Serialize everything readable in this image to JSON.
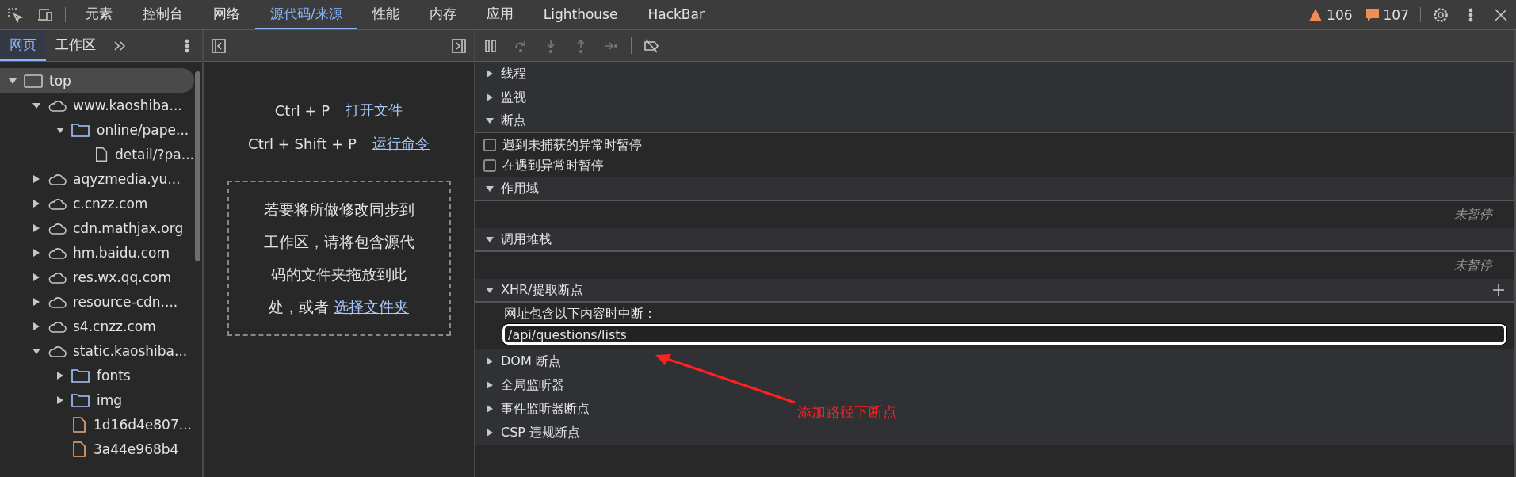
{
  "toolbar": {
    "tabs": [
      {
        "label": "元素",
        "selected": false
      },
      {
        "label": "控制台",
        "selected": false
      },
      {
        "label": "网络",
        "selected": false
      },
      {
        "label": "源代码/来源",
        "selected": true
      },
      {
        "label": "性能",
        "selected": false
      },
      {
        "label": "内存",
        "selected": false
      },
      {
        "label": "应用",
        "selected": false
      },
      {
        "label": "Lighthouse",
        "selected": false
      },
      {
        "label": "HackBar",
        "selected": false
      }
    ],
    "warnings": "106",
    "issues": "107"
  },
  "navigator": {
    "tabs": [
      {
        "label": "网页",
        "selected": true
      },
      {
        "label": "工作区",
        "selected": false
      }
    ],
    "tree": [
      {
        "label": "top",
        "kind": "frame",
        "expanded": true,
        "selected": true,
        "children": [
          {
            "label": "www.kaoshiba...",
            "kind": "domain",
            "expanded": true,
            "selected": false,
            "children": [
              {
                "label": "online/pape...",
                "kind": "folder",
                "expanded": true,
                "selected": false,
                "children": [
                  {
                    "label": "detail/?pa...",
                    "kind": "document",
                    "selected": false
                  }
                ]
              }
            ]
          },
          {
            "label": "aqyzmedia.yu...",
            "kind": "domain",
            "expanded": false,
            "selected": false
          },
          {
            "label": "c.cnzz.com",
            "kind": "domain",
            "expanded": false,
            "selected": false
          },
          {
            "label": "cdn.mathjax.org",
            "kind": "domain",
            "expanded": false,
            "selected": false
          },
          {
            "label": "hm.baidu.com",
            "kind": "domain",
            "expanded": false,
            "selected": false
          },
          {
            "label": "res.wx.qq.com",
            "kind": "domain",
            "expanded": false,
            "selected": false
          },
          {
            "label": "resource-cdn....",
            "kind": "domain",
            "expanded": false,
            "selected": false
          },
          {
            "label": "s4.cnzz.com",
            "kind": "domain",
            "expanded": false,
            "selected": false
          },
          {
            "label": "static.kaoshiba...",
            "kind": "domain",
            "expanded": true,
            "selected": false,
            "children": [
              {
                "label": "fonts",
                "kind": "folder",
                "expanded": false,
                "selected": false
              },
              {
                "label": "img",
                "kind": "folder",
                "expanded": false,
                "selected": false
              },
              {
                "label": "1d16d4e807...",
                "kind": "resource",
                "selected": false
              },
              {
                "label": "3a44e968b4",
                "kind": "resource",
                "selected": false
              }
            ]
          }
        ]
      }
    ]
  },
  "editor": {
    "shortcuts": [
      {
        "keys": "Ctrl + P",
        "action": "打开文件"
      },
      {
        "keys": "Ctrl + Shift + P",
        "action": "运行命令"
      }
    ],
    "hint": "若要将所做修改同步到工作区，请将包含源代码的文件夹拖放到此处，或者",
    "hint_link": "选择文件夹"
  },
  "debugger": {
    "sections": [
      {
        "title": "线程",
        "expanded": false
      },
      {
        "title": "监视",
        "expanded": false
      },
      {
        "title": "断点",
        "expanded": true,
        "body": [
          {
            "kind": "checkbox",
            "label": "遇到未捕获的异常时暂停",
            "checked": false
          },
          {
            "kind": "checkbox",
            "label": "在遇到异常时暂停",
            "checked": false
          }
        ]
      },
      {
        "title": "作用域",
        "expanded": true,
        "body": [
          {
            "kind": "status",
            "label": "未暂停"
          }
        ]
      },
      {
        "title": "调用堆栈",
        "expanded": true,
        "body": [
          {
            "kind": "status",
            "label": "未暂停"
          }
        ]
      },
      {
        "title": "XHR/提取断点",
        "expanded": true,
        "addable": true,
        "body": [
          {
            "kind": "caption",
            "label": "网址包含以下内容时中断："
          },
          {
            "kind": "input",
            "value": "/api/questions/lists"
          }
        ]
      },
      {
        "title": "DOM 断点",
        "expanded": false
      },
      {
        "title": "全局监听器",
        "expanded": false
      },
      {
        "title": "事件监听器断点",
        "expanded": false
      },
      {
        "title": "CSP 违规断点",
        "expanded": false
      }
    ]
  },
  "annotation": {
    "text": "添加路径下断点"
  }
}
